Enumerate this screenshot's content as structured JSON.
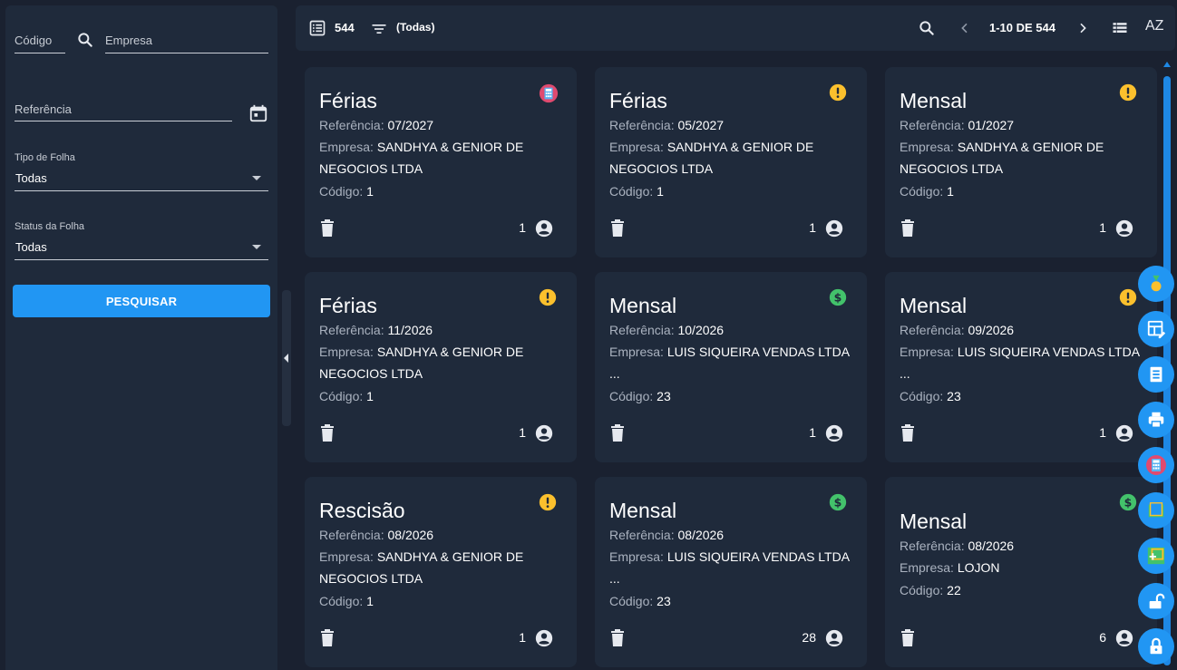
{
  "filters": {
    "codigo_label": "Código",
    "empresa_label": "Empresa",
    "referencia_label": "Referência",
    "tipo_label": "Tipo de Folha",
    "tipo_value": "Todas",
    "status_label": "Status da Folha",
    "status_value": "Todas",
    "search_button": "PESQUISAR"
  },
  "toolbar": {
    "total": "544",
    "filter_value": "(Todas)",
    "pagination": "1-10 DE 544",
    "sort_label": "AZ"
  },
  "cards": [
    {
      "title": "Férias",
      "ref_label": "Referência:",
      "ref": "07/2027",
      "emp_label": "Empresa:",
      "emp": "SANDHYA & GENIOR DE NEGOCIOS LTDA",
      "cod_label": "Código:",
      "cod": "1",
      "count": "1",
      "status": "calculator-icon"
    },
    {
      "title": "Férias",
      "ref_label": "Referência:",
      "ref": "05/2027",
      "emp_label": "Empresa:",
      "emp": "SANDHYA & GENIOR DE NEGOCIOS LTDA",
      "cod_label": "Código:",
      "cod": "1",
      "count": "1",
      "status": "alert-icon"
    },
    {
      "title": "Mensal",
      "ref_label": "Referência:",
      "ref": "01/2027",
      "emp_label": "Empresa:",
      "emp": "SANDHYA & GENIOR DE NEGOCIOS LTDA",
      "cod_label": "Código:",
      "cod": "1",
      "count": "1",
      "status": "alert-icon"
    },
    {
      "title": "Férias",
      "ref_label": "Referência:",
      "ref": "11/2026",
      "emp_label": "Empresa:",
      "emp": "SANDHYA & GENIOR DE NEGOCIOS LTDA",
      "cod_label": "Código:",
      "cod": "1",
      "count": "1",
      "status": "alert-icon"
    },
    {
      "title": "Mensal",
      "ref_label": "Referência:",
      "ref": "10/2026",
      "emp_label": "Empresa:",
      "emp": "LUIS SIQUEIRA VENDAS LTDA ...",
      "cod_label": "Código:",
      "cod": "23",
      "count": "1",
      "status": "dollar-icon"
    },
    {
      "title": "Mensal",
      "ref_label": "Referência:",
      "ref": "09/2026",
      "emp_label": "Empresa:",
      "emp": "LUIS SIQUEIRA VENDAS LTDA ...",
      "cod_label": "Código:",
      "cod": "23",
      "count": "1",
      "status": "alert-icon"
    },
    {
      "title": "Rescisão",
      "ref_label": "Referência:",
      "ref": "08/2026",
      "emp_label": "Empresa:",
      "emp": "SANDHYA & GENIOR DE NEGOCIOS LTDA",
      "cod_label": "Código:",
      "cod": "1",
      "count": "1",
      "status": "alert-icon"
    },
    {
      "title": "Mensal",
      "ref_label": "Referência:",
      "ref": "08/2026",
      "emp_label": "Empresa:",
      "emp": "LUIS SIQUEIRA VENDAS LTDA ...",
      "cod_label": "Código:",
      "cod": "23",
      "count": "28",
      "status": "dollar-icon"
    },
    {
      "title": "Mensal",
      "ref_label": "Referência:",
      "ref": "08/2026",
      "emp_label": "Empresa:",
      "emp": "LOJON",
      "cod_label": "Código:",
      "cod": "22",
      "count": "6",
      "status": "dollar-icon"
    }
  ],
  "colors": {
    "accent": "#2196f3",
    "warning": "#fbc02d",
    "success": "#43c26b",
    "card_bg": "#1f2a3b",
    "page_bg": "#1a2130"
  },
  "fabs": [
    "medal-icon",
    "dashboard-edit-icon",
    "receipt-icon",
    "print-icon",
    "calculator-icon",
    "folder-icon",
    "add-box-icon",
    "unlock-icon",
    "lock-icon"
  ]
}
